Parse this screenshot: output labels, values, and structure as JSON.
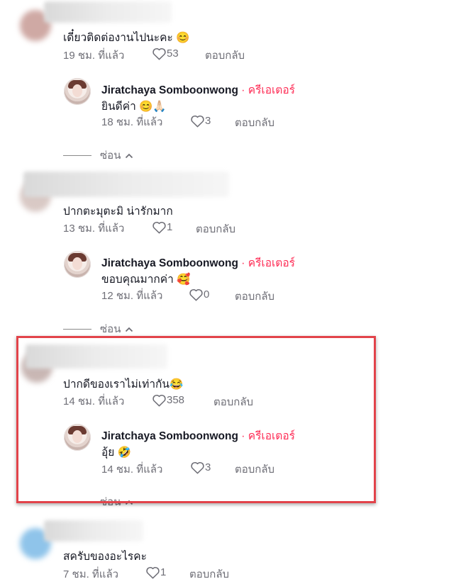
{
  "comments": [
    {
      "text": "เดี๋ยวติดต่องานไปนะคะ 😊",
      "time": "19 ชม. ที่แล้ว",
      "likes": "53",
      "reply_label": "ตอบกลับ",
      "creator_reply": {
        "name": "Jiratchaya Somboonwong",
        "badge": "· ครีเอเตอร์",
        "text": "ยินดีค่า 😊🙏🏻",
        "time": "18 ชม. ที่แล้ว",
        "likes": "3",
        "reply_label": "ตอบกลับ"
      },
      "hide_label": "ซ่อน"
    },
    {
      "text": "ปากตะมุตะมิ น่ารักมาก",
      "time": "13 ชม. ที่แล้ว",
      "likes": "1",
      "reply_label": "ตอบกลับ",
      "creator_reply": {
        "name": "Jiratchaya Somboonwong",
        "badge": "· ครีเอเตอร์",
        "text": "ขอบคุณมากค่า 🥰",
        "time": "12 ชม. ที่แล้ว",
        "likes": "0",
        "reply_label": "ตอบกลับ"
      },
      "hide_label": "ซ่อน"
    },
    {
      "text": "ปากดีของเราไม่เท่ากัน😂",
      "time": "14 ชม. ที่แล้ว",
      "likes": "358",
      "reply_label": "ตอบกลับ",
      "creator_reply": {
        "name": "Jiratchaya Somboonwong",
        "badge": "· ครีเอเตอร์",
        "text": "อุ้ย 🤣",
        "time": "14 ชม. ที่แล้ว",
        "likes": "3",
        "reply_label": "ตอบกลับ"
      },
      "hide_label": "ซ่อน"
    },
    {
      "text": "สครับของอะไรคะ",
      "time": "7 ชม. ที่แล้ว",
      "likes": "1",
      "reply_label": "ตอบกลับ"
    }
  ],
  "colors": {
    "creator_accent": "#fe2c55",
    "highlight_border": "#e2434a",
    "meta_text": "#6f6f77"
  },
  "icons": {
    "like": "heart-outline-icon",
    "collapse": "chevron-up-icon"
  }
}
